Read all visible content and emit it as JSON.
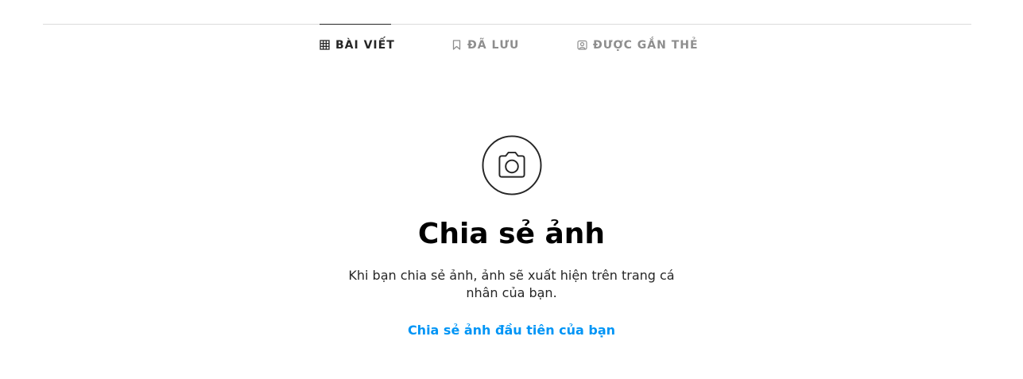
{
  "tabs": [
    {
      "label": "BÀI VIẾT",
      "icon": "grid-icon",
      "active": true
    },
    {
      "label": "ĐÃ LƯU",
      "icon": "bookmark-icon",
      "active": false
    },
    {
      "label": "ĐƯỢC GẮN THẺ",
      "icon": "tagged-user-icon",
      "active": false
    }
  ],
  "empty_state": {
    "icon": "camera-icon",
    "title": "Chia sẻ ảnh",
    "description": "Khi bạn chia sẻ ảnh, ảnh sẽ xuất hiện trên trang cá nhân của bạn.",
    "link": "Chia sẻ ảnh đầu tiên của bạn"
  },
  "colors": {
    "active_tab": "#262626",
    "inactive_tab": "#8e8e8e",
    "link": "#0095f6",
    "divider": "#dbdbdb"
  }
}
